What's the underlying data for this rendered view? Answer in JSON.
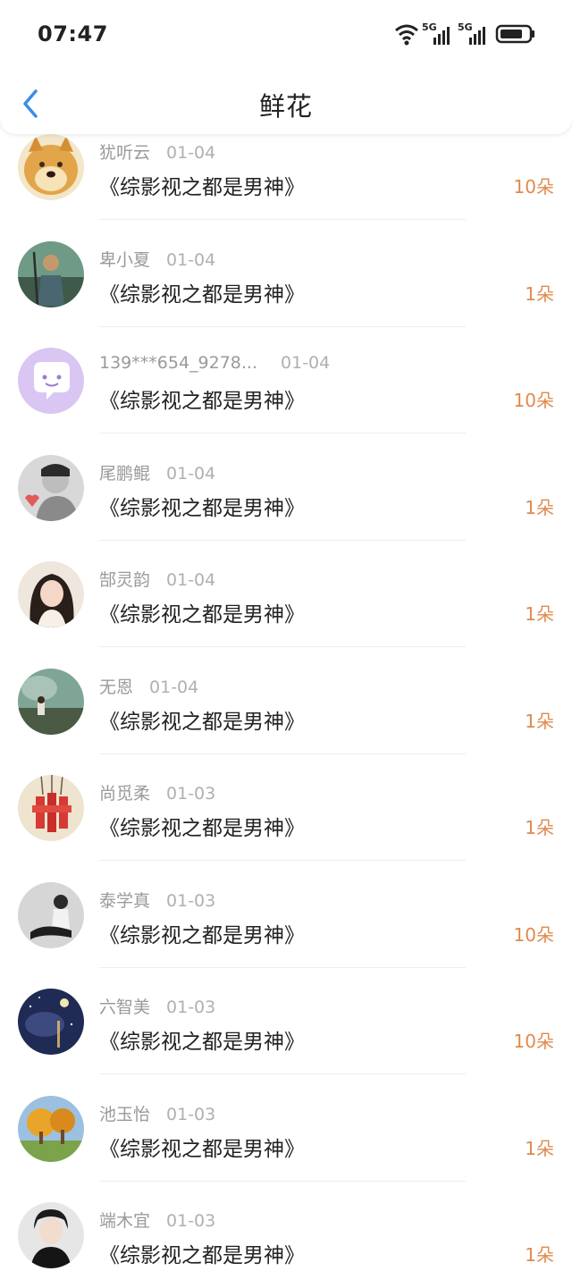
{
  "status_bar": {
    "time": "07:47",
    "net1": "5G",
    "net2": "5G"
  },
  "header": {
    "title": "鲜花"
  },
  "colors": {
    "accent_orange": "#e08a4e",
    "back_blue": "#3a8ee6"
  },
  "items": [
    {
      "name": "犹听云",
      "date": "01-04",
      "book": "《综影视之都是男神》",
      "count": "10朵"
    },
    {
      "name": "卑小夏",
      "date": "01-04",
      "book": "《综影视之都是男神》",
      "count": "1朵"
    },
    {
      "name": "139***654_9278...",
      "date": "01-04",
      "book": "《综影视之都是男神》",
      "count": "10朵"
    },
    {
      "name": "尾鹏鲲",
      "date": "01-04",
      "book": "《综影视之都是男神》",
      "count": "1朵"
    },
    {
      "name": "郜灵韵",
      "date": "01-04",
      "book": "《综影视之都是男神》",
      "count": "1朵"
    },
    {
      "name": "无恩",
      "date": "01-04",
      "book": "《综影视之都是男神》",
      "count": "1朵"
    },
    {
      "name": "尚觅柔",
      "date": "01-03",
      "book": "《综影视之都是男神》",
      "count": "1朵"
    },
    {
      "name": "泰学真",
      "date": "01-03",
      "book": "《综影视之都是男神》",
      "count": "10朵"
    },
    {
      "name": "六智美",
      "date": "01-03",
      "book": "《综影视之都是男神》",
      "count": "10朵"
    },
    {
      "name": "池玉怡",
      "date": "01-03",
      "book": "《综影视之都是男神》",
      "count": "1朵"
    },
    {
      "name": "端木宜",
      "date": "01-03",
      "book": "《综影视之都是男神》",
      "count": "1朵"
    }
  ]
}
